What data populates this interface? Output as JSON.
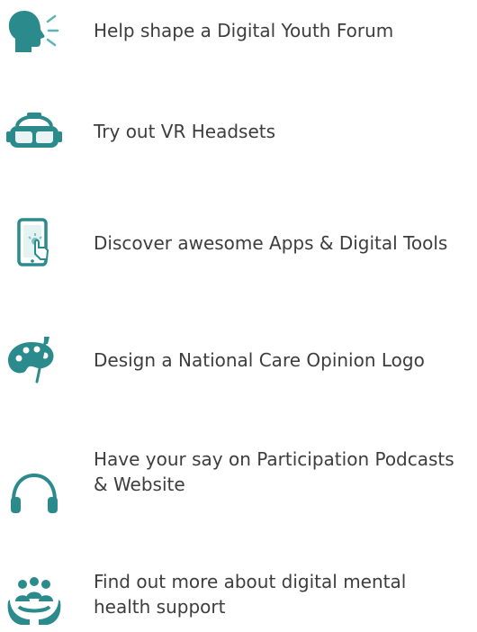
{
  "accent_color": "#2a8a8c",
  "items": [
    {
      "icon": "speaking-head-icon",
      "label": "Help shape a Digital Youth Forum"
    },
    {
      "icon": "vr-headset-icon",
      "label": "Try out VR Headsets"
    },
    {
      "icon": "tablet-touch-icon",
      "label": "Discover awesome Apps & Digital Tools"
    },
    {
      "icon": "paint-palette-icon",
      "label": "Design a National Care Opinion Logo"
    },
    {
      "icon": "headphones-icon",
      "label": "Have your say on Participation Podcasts\n& Website"
    },
    {
      "icon": "people-support-icon",
      "label": "Find out more about digital mental\nhealth support"
    }
  ]
}
